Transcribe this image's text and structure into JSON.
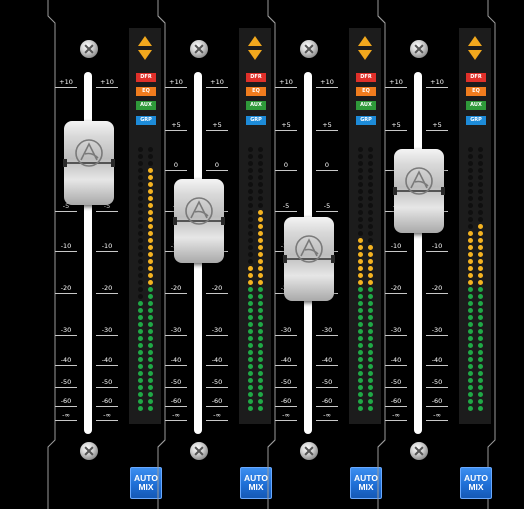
{
  "mixer": {
    "scale_marks": [
      "+10",
      "+5",
      "0",
      "-5",
      "-10",
      "-20",
      "-30",
      "-40",
      "-50",
      "-60",
      "-∞"
    ],
    "first_strip_scale_marks": [
      "+10",
      "-5",
      "-10",
      "-20",
      "-30",
      "-40",
      "-50",
      "-60",
      "-∞"
    ],
    "sends": [
      {
        "label": "DFR",
        "color": "#e0302a",
        "text": "#ffffff"
      },
      {
        "label": "EQ",
        "color": "#f07c1e",
        "text": "#ffffff"
      },
      {
        "label": "AUX",
        "color": "#2f9a3a",
        "text": "#ffffff"
      },
      {
        "label": "GRP",
        "color": "#1d8bd8",
        "text": "#ffffff"
      }
    ],
    "automix_label": "AUTO MIX",
    "meter_colors": {
      "off": "#0f0f0f",
      "green": "#1fa946",
      "yellow": "#f5b320"
    },
    "channels": [
      {
        "fader_level": 0.22,
        "meter_left": 0.43,
        "meter_right": 0.92
      },
      {
        "fader_level": 0.45,
        "meter_left": 0.56,
        "meter_right": 0.75
      },
      {
        "fader_level": 0.6,
        "meter_left": 0.67,
        "meter_right": 0.64
      },
      {
        "fader_level": 0.33,
        "meter_left": 0.68,
        "meter_right": 0.72
      }
    ]
  }
}
